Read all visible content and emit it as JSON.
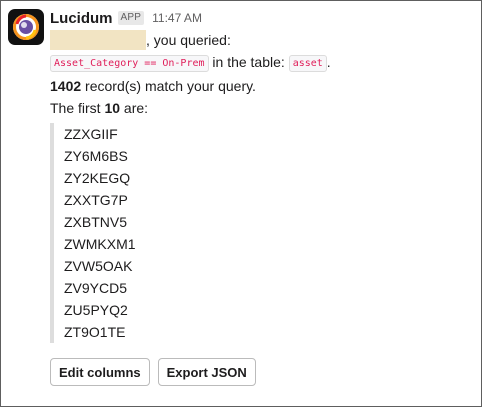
{
  "message": {
    "sender": "Lucidum",
    "badge": "APP",
    "time": "11:47 AM",
    "intro_suffix": ", you queried:",
    "query_code": "Asset_Category == On-Prem",
    "table_prefix": "in the table:",
    "table_code": "asset",
    "table_suffix": ".",
    "match_count": "1402",
    "match_suffix": " record(s) match your query.",
    "first_prefix": "The first ",
    "first_count": "10",
    "first_suffix": " are:",
    "records": [
      "ZZXGIIF",
      "ZY6M6BS",
      "ZY2KEGQ",
      "ZXXTG7P",
      "ZXBTNV5",
      "ZWMKXM1",
      "ZVW5OAK",
      "ZV9YCD5",
      "ZU5PYQ2",
      "ZT9O1TE"
    ]
  },
  "actions": {
    "edit_columns": "Edit columns",
    "export_json": "Export JSON"
  }
}
